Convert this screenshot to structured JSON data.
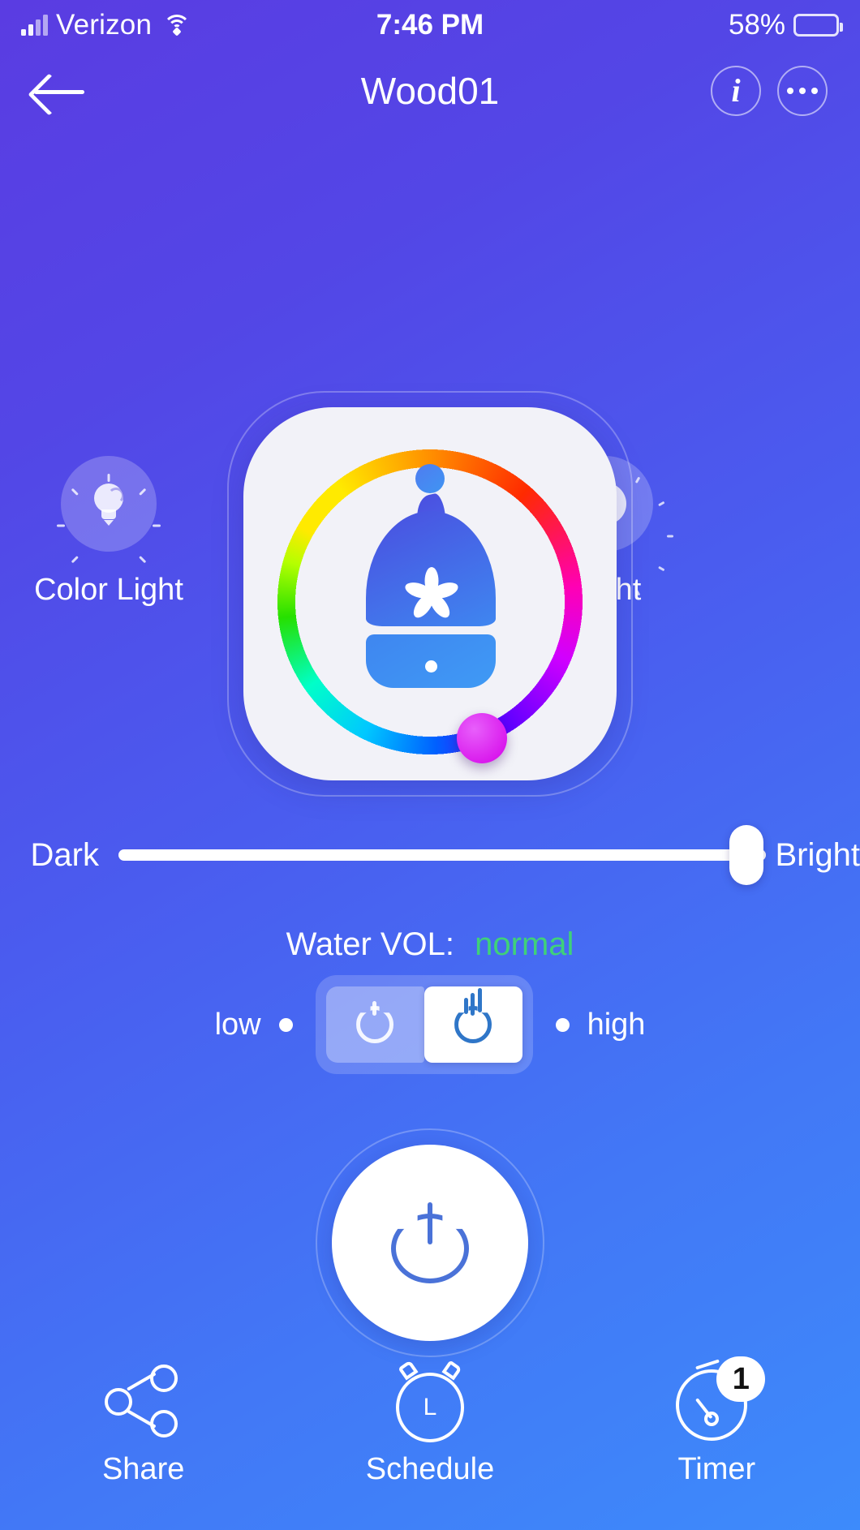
{
  "status_bar": {
    "carrier": "Verizon",
    "time": "7:46 PM",
    "battery_percent": "58%",
    "wifi_icon": "wifi-icon",
    "signal_icon": "cellular-signal-icon",
    "battery_icon": "battery-icon"
  },
  "nav": {
    "back_icon": "back-arrow-icon",
    "title": "Wood01",
    "info_label": "i",
    "info_icon": "info-icon",
    "more_icon": "more-options-icon"
  },
  "modes": {
    "left": {
      "label": "Color Light",
      "icon": "lightbulb-icon"
    },
    "right": {
      "label": "Night",
      "icon": "moon-icon"
    }
  },
  "color_wheel": {
    "name": "color-wheel",
    "center_icon": "diffuser-icon",
    "handle_color": "#d400e8",
    "dot_color": "#4f7cf0"
  },
  "brightness": {
    "min_label": "Dark",
    "max_label": "Bright",
    "value_percent": 97
  },
  "water": {
    "label": "Water VOL:",
    "value": "normal",
    "value_color": "#3fd17a"
  },
  "mist": {
    "low_label": "low",
    "high_label": "high",
    "inactive_icon": "mist-low-icon",
    "active_icon": "mist-high-icon",
    "selected": "high"
  },
  "power": {
    "icon": "power-icon",
    "state": "on"
  },
  "bottom_bar": [
    {
      "label": "Share",
      "icon": "share-icon",
      "badge": ""
    },
    {
      "label": "Schedule",
      "icon": "alarm-clock-icon",
      "clock_letter": "L",
      "badge": ""
    },
    {
      "label": "Timer",
      "icon": "stopwatch-icon",
      "badge": "1"
    }
  ]
}
